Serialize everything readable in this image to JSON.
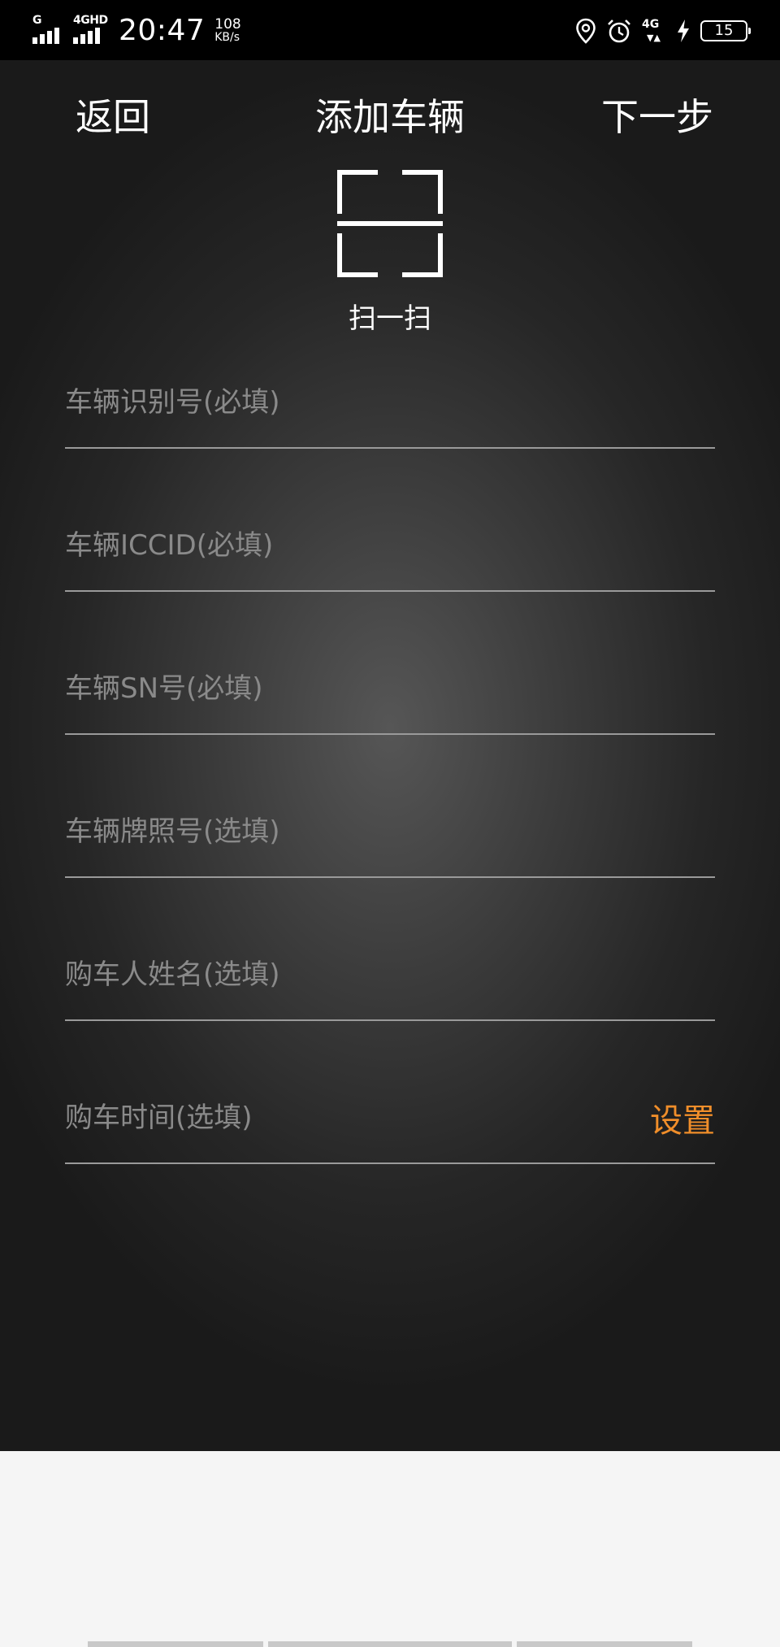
{
  "status_bar": {
    "sim1_tag": "G",
    "sim2_tag": "4GHD",
    "time": "20:47",
    "speed_value": "108",
    "speed_unit": "KB/s",
    "network": "4G",
    "battery": "15",
    "icons": [
      "location-icon",
      "alarm-icon",
      "charging-icon"
    ]
  },
  "header": {
    "back": "返回",
    "title": "添加车辆",
    "next": "下一步"
  },
  "scan": {
    "label": "扫一扫",
    "icon": "scan-frame-icon"
  },
  "form": {
    "fields": [
      {
        "placeholder": "车辆识别号(必填)",
        "value": ""
      },
      {
        "placeholder": "车辆ICCID(必填)",
        "value": ""
      },
      {
        "placeholder": "车辆SN号(必填)",
        "value": ""
      },
      {
        "placeholder": "车辆牌照号(选填)",
        "value": ""
      },
      {
        "placeholder": "购车人姓名(选填)",
        "value": ""
      },
      {
        "placeholder": "购车时间(选填)",
        "value": ""
      }
    ],
    "set_label": "设置"
  },
  "colors": {
    "accent": "#f08e2a",
    "status_bar_bg": "#000000",
    "divider": "#9a9a9a",
    "bottom_bg": "#f5f5f5"
  }
}
